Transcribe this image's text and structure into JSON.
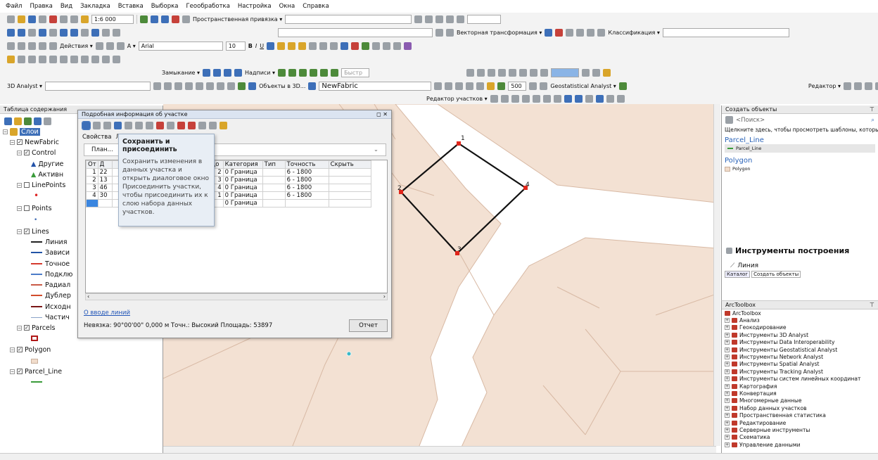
{
  "menu": [
    "Файл",
    "Правка",
    "Вид",
    "Закладка",
    "Вставка",
    "Выборка",
    "Геообработка",
    "Настройка",
    "Окна",
    "Справка"
  ],
  "toolbar": {
    "scale": "1:6 000",
    "snapping": "Пространственная привязка ▾",
    "vector_transform": "Векторная трансформация ▾",
    "classification": "Классификация ▾",
    "actions": "Действия ▾",
    "font": "Arial",
    "font_size": "10",
    "closure": "Замыкание ▾",
    "labels": "Надписи ▾",
    "quick": "Быстр",
    "analyst3d": "3D Analyst ▾",
    "objects3d": "Объекты в 3D...",
    "fabric": "NewFabric",
    "zoom_value": "500",
    "geostat": "Geostatistical Analyst ▾",
    "editor": "Редактор ▾",
    "parcel_editor": "Редактор участков ▾"
  },
  "toc": {
    "title": "Таблица содержания",
    "layers_root": "Слои",
    "items": [
      "NewFabric",
      "Control",
      "Другие",
      "Активн",
      "LinePoints",
      "Points",
      "Lines",
      "Линия",
      "Зависи",
      "Точное",
      "Подклю",
      "Радиал",
      "Дублер",
      "Исходн",
      "Частич",
      "Parcels",
      "Polygon",
      "Parcel_Line"
    ]
  },
  "dialog": {
    "title": "Подробная информация об участке",
    "tab_props": "Свойства",
    "tab_lines": "Л",
    "plan_label": "План...",
    "headers": [
      "От",
      "Д",
      "",
      "До",
      "Категория",
      "Тип",
      "Точность",
      "Скрыть"
    ],
    "rows": [
      [
        "1",
        "22",
        "",
        "2",
        "0",
        "Граница",
        "",
        "6 - 1800"
      ],
      [
        "2",
        "13",
        "",
        "3",
        "0",
        "Граница",
        "",
        "6 - 1800"
      ],
      [
        "3",
        "46",
        "",
        "4",
        "0",
        "Граница",
        "",
        "6 - 1800"
      ],
      [
        "4",
        "30",
        "",
        "1",
        "0",
        "Граница",
        "",
        "6 - 1800"
      ],
      [
        "",
        "",
        "",
        "",
        "0",
        "Граница",
        "",
        ""
      ]
    ],
    "link": "О вводе линий",
    "status": "Невязка: 90°00'00\" 0,000 м  Точн.: Высокий  Площадь: 53897",
    "report_btn": "Отчет",
    "tooltip_title": "Сохранить и присоединить",
    "tooltip_body": "Сохранить изменения в данных участка и открыть диалоговое окно Присоединить участки, чтобы присоединить их к слою набора данных участков."
  },
  "map": {
    "points": [
      "1",
      "2",
      "3",
      "4"
    ]
  },
  "create": {
    "title": "Создать объекты",
    "search": "<Поиск>",
    "hint": "Щелкните здесь, чтобы просмотреть шаблоны, которые не",
    "group1": "Parcel_Line",
    "item1": "Parcel_Line",
    "group2": "Polygon",
    "item2": "Polygon"
  },
  "tools": {
    "title": "Инструменты построения",
    "item": "Линия",
    "catalog": "Каталог",
    "create_btn": "Создать объекты"
  },
  "arctoolbox": {
    "title": "ArcToolbox",
    "root": "ArcToolbox",
    "items": [
      "Анализ",
      "Геокодирование",
      "Инструменты 3D Analyst",
      "Инструменты Data Interoperability",
      "Инструменты Geostatistical Analyst",
      "Инструменты Network Analyst",
      "Инструменты Spatial Analyst",
      "Инструменты Tracking Analyst",
      "Инструменты систем линейных координат",
      "Картография",
      "Конвертация",
      "Многомерные данные",
      "Набор данных участков",
      "Пространственная статистика",
      "Редактирование",
      "Серверные инструменты",
      "Схематика",
      "Управление данными"
    ]
  },
  "colors": {
    "parcel_fill": "#f3e1d3",
    "road": "#ffffff",
    "line": "#d8b9a4",
    "vertex": "#e0261b",
    "accent": "#3d6fb8"
  }
}
